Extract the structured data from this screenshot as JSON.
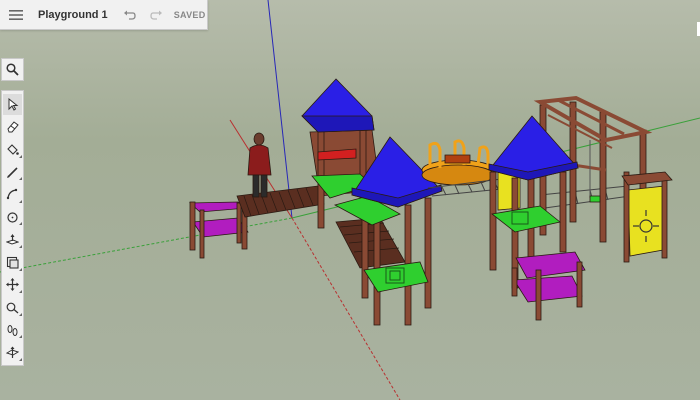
{
  "document": {
    "title": "Playground 1",
    "save_status": "SAVED"
  },
  "topbar": {
    "icons": [
      "menu-icon",
      "undo-icon",
      "redo-icon"
    ]
  },
  "search": {
    "icon": "search-icon"
  },
  "toolbar": {
    "tools": [
      {
        "name": "select",
        "icon": "cursor-arrow-icon",
        "active": true
      },
      {
        "name": "eraser",
        "icon": "eraser-icon"
      },
      {
        "name": "paint-bucket",
        "icon": "paint-bucket-icon"
      },
      {
        "name": "line",
        "icon": "pencil-icon"
      },
      {
        "name": "arc",
        "icon": "arc-icon"
      },
      {
        "name": "circle",
        "icon": "circle-icon"
      },
      {
        "name": "push-pull",
        "icon": "push-pull-icon"
      },
      {
        "name": "offset",
        "icon": "offset-icon"
      },
      {
        "name": "move",
        "icon": "move-arrows-icon"
      },
      {
        "name": "tape-measure",
        "icon": "tape-measure-icon"
      },
      {
        "name": "walk",
        "icon": "footprints-icon"
      },
      {
        "name": "section-plane",
        "icon": "section-plane-icon"
      }
    ]
  },
  "colors": {
    "sky": "#a9b2a0",
    "roof_blue": "#2a1fe6",
    "deck_green": "#2fcf2f",
    "seat_purple": "#b11dbf",
    "panel_yellow": "#e8e120",
    "wood_brown": "#8a4a34",
    "carousel_orange": "#f0a21a"
  }
}
